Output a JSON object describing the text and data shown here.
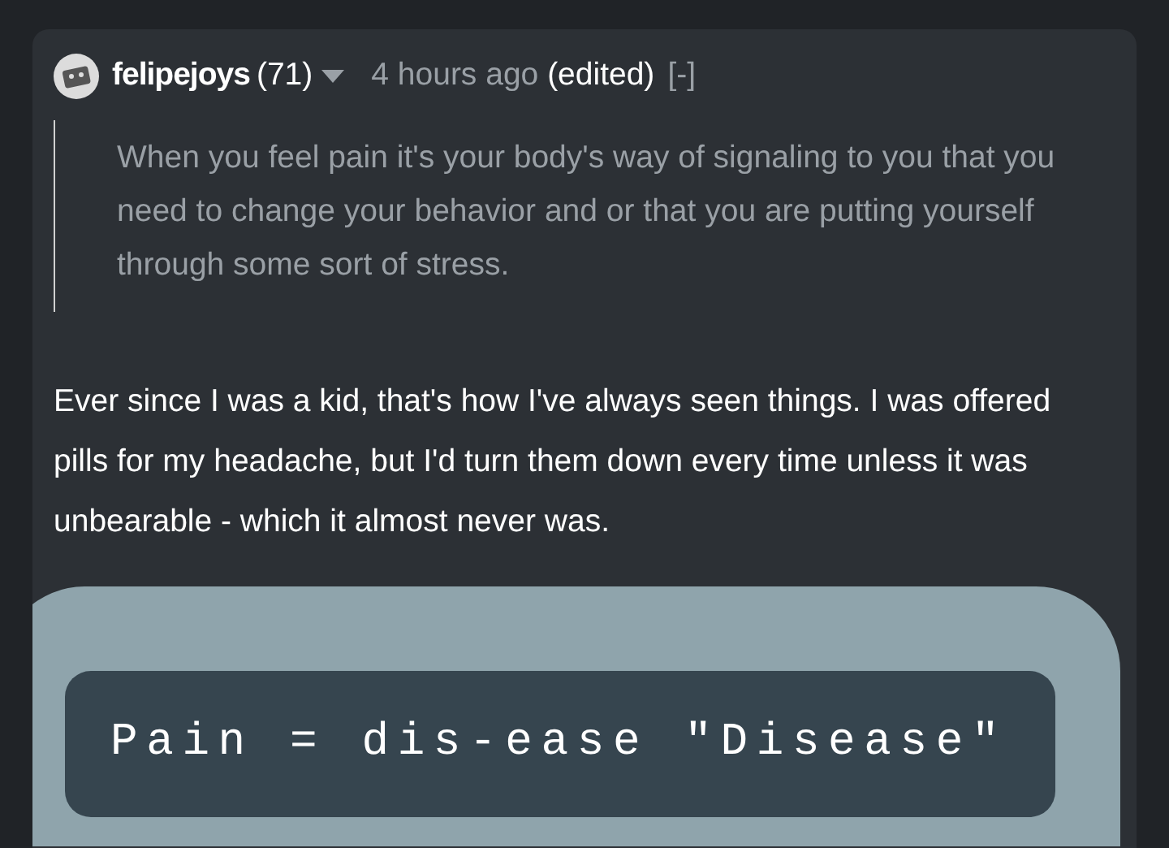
{
  "comment": {
    "author": "felipejoys",
    "score": "(71)",
    "time": "4 hours ago",
    "edited": "(edited)",
    "collapse": "[-]",
    "quote": "When you feel pain it's your body's way of signaling to you that you need to change your behavior and or that you are putting yourself through some sort of stress.",
    "body": "Ever since I was a kid, that's how I've always seen things. I was offered pills for my headache, but I'd turn them down every time unless it was unbearable - which it almost never was."
  },
  "overlay": {
    "code": "Pain = dis-ease \"Disease\""
  }
}
